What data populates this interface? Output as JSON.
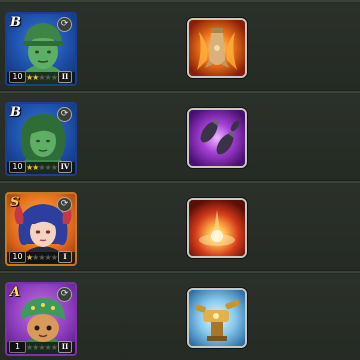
{
  "colors": {
    "background": "#272c26",
    "star_on": "#f2c02f",
    "star_off": "#5b5d57"
  },
  "heroes": [
    {
      "grade": "B",
      "level": "10",
      "stars_filled": 2,
      "stars_total": 6,
      "rank": "II",
      "frame_color": "blue",
      "portrait_icon": "green-army-soldier-icon",
      "skill_icon": "flaming-bomb-icon",
      "skill_color": "orange"
    },
    {
      "grade": "B",
      "level": "10",
      "stars_filled": 2,
      "stars_total": 6,
      "rank": "IV",
      "frame_color": "blue",
      "portrait_icon": "green-army-woman-icon",
      "skill_icon": "falling-bombs-icon",
      "skill_color": "purple"
    },
    {
      "grade": "S",
      "level": "10",
      "stars_filled": 1,
      "stars_total": 6,
      "rank": "I",
      "frame_color": "gold",
      "portrait_icon": "blue-haired-heroine-icon",
      "skill_icon": "explosion-blast-icon",
      "skill_color": "red"
    },
    {
      "grade": "A",
      "level": "1",
      "stars_filled": 0,
      "stars_total": 6,
      "rank": "II",
      "frame_color": "purple",
      "portrait_icon": "toy-soldier-helmet-icon",
      "skill_icon": "golden-turret-icon",
      "skill_color": "blue"
    }
  ]
}
